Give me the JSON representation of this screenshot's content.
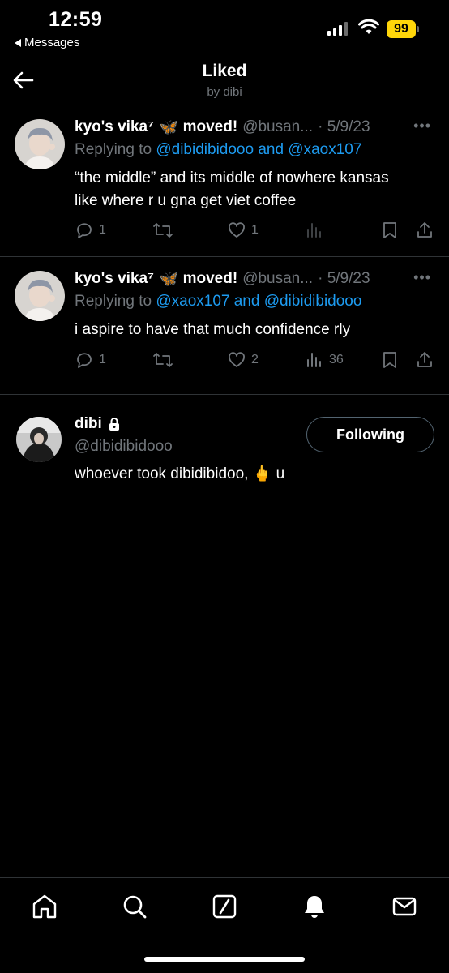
{
  "status_bar": {
    "time": "12:59",
    "back_app": "Messages",
    "battery": "99",
    "battery_color": "#ffd60a"
  },
  "header": {
    "title": "Liked",
    "subtitle": "by dibi"
  },
  "tweets": [
    {
      "name": "kyo's vika⁷",
      "emoji": "🦋",
      "name_suffix": "moved!",
      "handle": "@busan...",
      "date": "· 5/9/23",
      "replying_prefix": "Replying to",
      "replying_mentions": "@dibidibidooo and @xaox107",
      "text": "“the middle” and its middle of nowhere kansas like where r u gna get viet coffee",
      "replies": "1",
      "retweets": "",
      "likes": "1",
      "views": ""
    },
    {
      "name": "kyo's vika⁷",
      "emoji": "🦋",
      "name_suffix": "moved!",
      "handle": "@busan...",
      "date": "· 5/9/23",
      "replying_prefix": "Replying to",
      "replying_mentions": "@xaox107 and @dibidibidooo",
      "text": "i aspire to have that much confidence rly",
      "replies": "1",
      "retweets": "",
      "likes": "2",
      "views": "36"
    }
  ],
  "profile_card": {
    "name": "dibi",
    "handle": "@dibidibidooo",
    "bio": "whoever took dibidibidoo, 🖕 u",
    "follow_label": "Following"
  },
  "colors": {
    "accent": "#1d9bf0",
    "muted": "#71767b",
    "border": "#2f3336"
  },
  "bottom_nav": [
    "home-icon",
    "search-icon",
    "grok-icon",
    "notifications-icon",
    "messages-icon"
  ]
}
